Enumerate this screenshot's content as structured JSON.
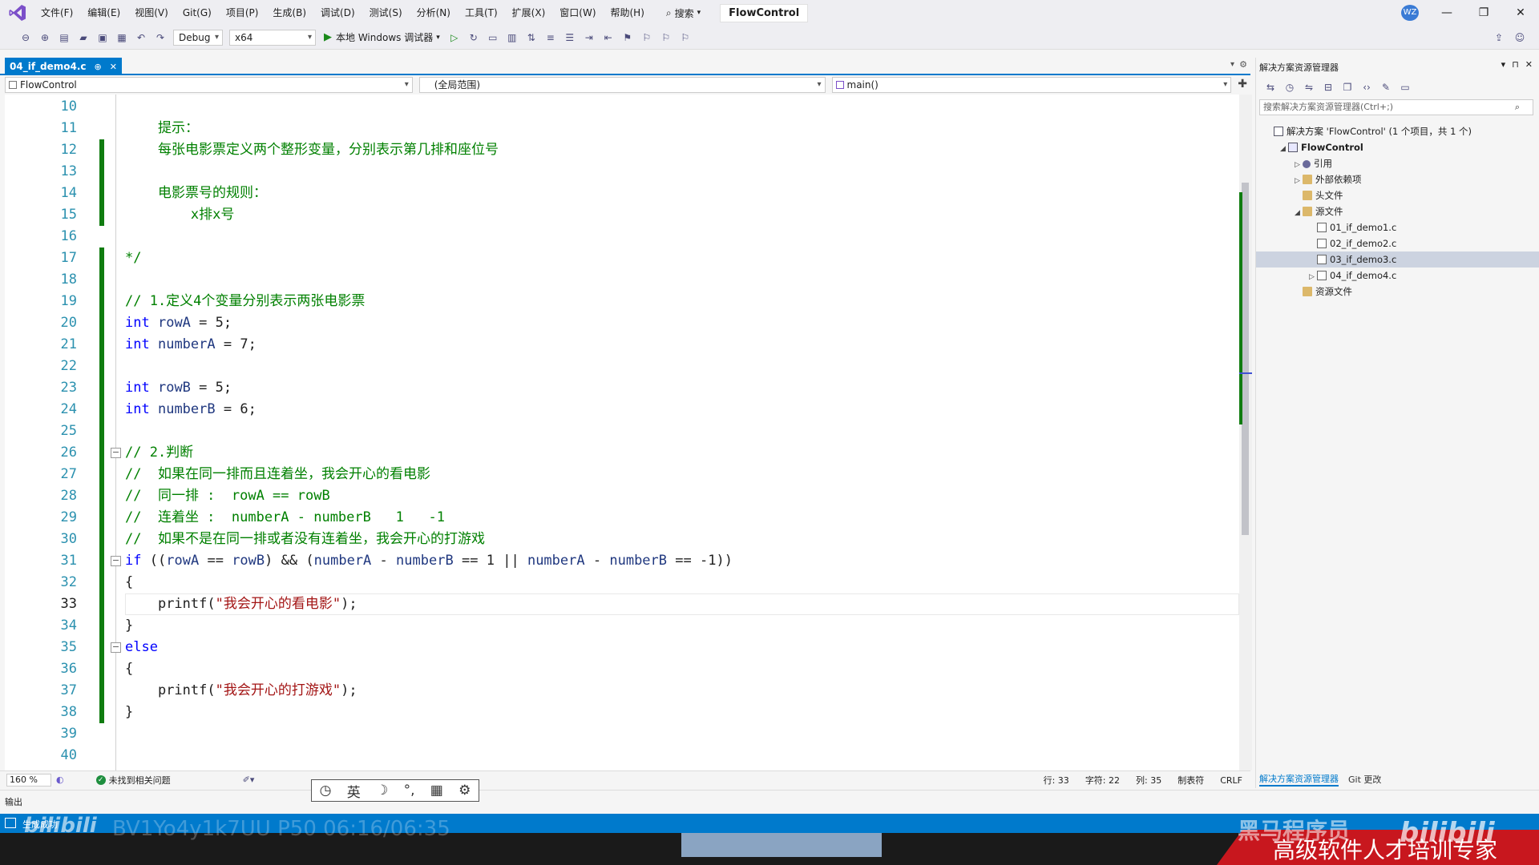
{
  "menu": [
    "文件(F)",
    "编辑(E)",
    "视图(V)",
    "Git(G)",
    "项目(P)",
    "生成(B)",
    "调试(D)",
    "测试(S)",
    "分析(N)",
    "工具(T)",
    "扩展(X)",
    "窗口(W)",
    "帮助(H)"
  ],
  "search_label": "搜索",
  "solution_title": "FlowControl",
  "avatar_initials": "WZ",
  "window": {
    "minimize": "—",
    "restore": "❐",
    "close": "✕"
  },
  "toolbar": {
    "config": "Debug",
    "platform": "x64",
    "debug_target": "本地 Windows 调试器"
  },
  "tab": {
    "name": "04_if_demo4.c",
    "pin": "⊕",
    "close": "✕"
  },
  "nav": {
    "project": "FlowControl",
    "scope": "(全局范围)",
    "func": "main()"
  },
  "editor": {
    "first_line": 10,
    "current_line": 33,
    "change_bars": [
      [
        12,
        15
      ],
      [
        17,
        38
      ]
    ],
    "folds": [
      26,
      31,
      35
    ]
  },
  "code": [
    "",
    "    提示：",
    "    每张电影票定义两个整形变量，分别表示第几排和座位号",
    "",
    "    电影票号的规则：",
    "        x排x号",
    "",
    "*/",
    "",
    "// 1.定义4个变量分别表示两张电影票",
    "int rowA = 5;",
    "int numberA = 7;",
    "",
    "int rowB = 5;",
    "int numberB = 6;",
    "",
    "// 2.判断",
    "//  如果在同一排而且连着坐，我会开心的看电影",
    "//  同一排 :  rowA == rowB",
    "//  连着坐 :  numberA - numberB   1   -1",
    "//  如果不是在同一排或者没有连着坐，我会开心的打游戏",
    "if ((rowA == rowB) && (numberA - numberB == 1 || numberA - numberB == -1))",
    "{",
    "    printf(\"我会开心的看电影\");",
    "}",
    "else",
    "{",
    "    printf(\"我会开心的打游戏\");",
    "}",
    "",
    ""
  ],
  "status": {
    "zoom": "160 %",
    "issues": "未找到相关问题",
    "line": "行: 33",
    "char": "字符: 22",
    "col": "列: 35",
    "tabs": "制表符",
    "eol": "CRLF"
  },
  "ime": [
    "英",
    "☽",
    "°,",
    "▦",
    "⚙"
  ],
  "output_label": "输出",
  "statusbar_text": "生成成功",
  "solution_explorer": {
    "title": "解决方案资源管理器",
    "search_placeholder": "搜索解决方案资源管理器(Ctrl+;)",
    "items": [
      {
        "label": "解决方案 'FlowControl' (1 个项目，共 1 个)",
        "indent": 0,
        "arrow": "",
        "icon": "sln"
      },
      {
        "label": "FlowControl",
        "indent": 1,
        "arrow": "◢",
        "icon": "proj",
        "bold": true
      },
      {
        "label": "引用",
        "indent": 2,
        "arrow": "▷",
        "icon": "ref"
      },
      {
        "label": "外部依赖项",
        "indent": 2,
        "arrow": "▷",
        "icon": "folder"
      },
      {
        "label": "头文件",
        "indent": 2,
        "arrow": "",
        "icon": "folder"
      },
      {
        "label": "源文件",
        "indent": 2,
        "arrow": "◢",
        "icon": "folder"
      },
      {
        "label": "01_if_demo1.c",
        "indent": 3,
        "arrow": "",
        "icon": "file"
      },
      {
        "label": "02_if_demo2.c",
        "indent": 3,
        "arrow": "",
        "icon": "file"
      },
      {
        "label": "03_if_demo3.c",
        "indent": 3,
        "arrow": "",
        "icon": "file",
        "selected": true
      },
      {
        "label": "04_if_demo4.c",
        "indent": 3,
        "arrow": "▷",
        "icon": "file"
      },
      {
        "label": "资源文件",
        "indent": 2,
        "arrow": "",
        "icon": "folder"
      }
    ],
    "bottom_tabs": {
      "se": "解决方案资源管理器",
      "git": "Git 更改"
    }
  },
  "overlay": {
    "ticker": "BV1Yo4y1k7UU P50 06:16/06:35",
    "watermark": "bilibili",
    "brand_name": "黑马程序员",
    "brand_slogan": "高级软件人才培训专家",
    "bili_logo": "bilibili"
  },
  "colors": {
    "accent": "#007acc",
    "keyword": "#0000ff",
    "comment": "#008000",
    "string": "#a31515",
    "identifier": "#1f377f",
    "line_number": "#2b91af",
    "change_bar": "#107c10"
  }
}
